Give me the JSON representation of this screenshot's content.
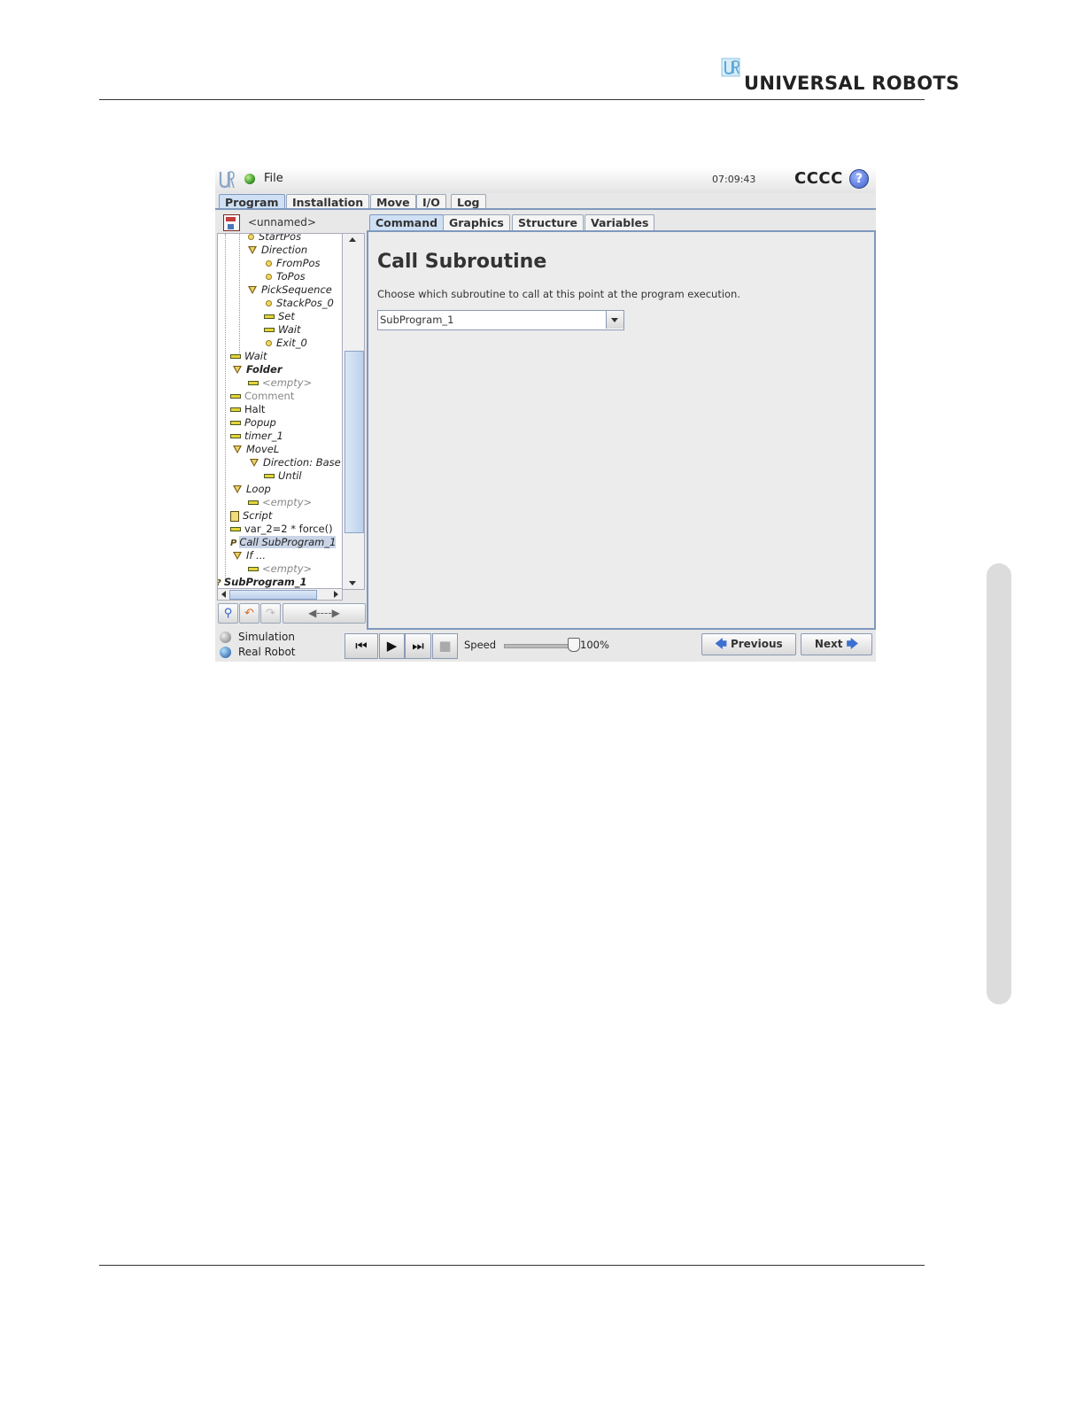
{
  "page": {
    "brand": "UNIVERSAL ROBOTS"
  },
  "header": {
    "file_menu": "File",
    "clock": "07:09:43",
    "robot_name": "CCCC",
    "help": "?"
  },
  "main_tabs": [
    {
      "label": "Program",
      "active": true
    },
    {
      "label": "Installation",
      "active": false
    },
    {
      "label": "Move",
      "active": false
    },
    {
      "label": "I/O",
      "active": false
    },
    {
      "label": "Log",
      "active": false
    }
  ],
  "sub_tabs": [
    {
      "label": "Command",
      "active": true
    },
    {
      "label": "Graphics",
      "active": false
    },
    {
      "label": "Structure",
      "active": false
    },
    {
      "label": "Variables",
      "active": false
    }
  ],
  "program": {
    "name": "<unnamed>"
  },
  "tree": [
    {
      "label": "StartPos",
      "icon": "waypoint-icon"
    },
    {
      "label": "Direction",
      "icon": "folder-triangle-icon"
    },
    {
      "label": "FromPos",
      "icon": "waypoint-icon"
    },
    {
      "label": "ToPos",
      "icon": "waypoint-icon"
    },
    {
      "label": "PickSequence",
      "icon": "folder-triangle-icon"
    },
    {
      "label": "StackPos_0",
      "icon": "waypoint-icon"
    },
    {
      "label": "Set",
      "icon": "command-bar-icon"
    },
    {
      "label": "Wait",
      "icon": "command-bar-icon"
    },
    {
      "label": "Exit_0",
      "icon": "waypoint-icon"
    },
    {
      "label": "Wait",
      "icon": "command-bar-icon"
    },
    {
      "label": "Folder",
      "icon": "folder-triangle-icon"
    },
    {
      "label": "<empty>",
      "icon": "command-bar-icon"
    },
    {
      "label": "Comment",
      "icon": "command-bar-icon"
    },
    {
      "label": "Halt",
      "icon": "command-bar-icon"
    },
    {
      "label": "Popup",
      "icon": "command-bar-icon"
    },
    {
      "label": "timer_1",
      "icon": "command-bar-icon"
    },
    {
      "label": "MoveL",
      "icon": "folder-triangle-icon"
    },
    {
      "label": "Direction: Base",
      "icon": "folder-triangle-icon"
    },
    {
      "label": "Until",
      "icon": "command-bar-icon"
    },
    {
      "label": "Loop",
      "icon": "folder-triangle-icon"
    },
    {
      "label": "<empty>",
      "icon": "command-bar-icon"
    },
    {
      "label": "Script",
      "icon": "script-icon"
    },
    {
      "label": "var_2=2 * force()",
      "icon": "command-bar-icon"
    },
    {
      "label": "Call SubProgram_1",
      "icon": "call-icon"
    },
    {
      "label": "If ...",
      "icon": "folder-triangle-icon"
    },
    {
      "label": "<empty>",
      "icon": "command-bar-icon"
    },
    {
      "label": "SubProgram_1",
      "icon": "call-icon"
    }
  ],
  "tree_toolbar": {
    "move_label": "◀----▶"
  },
  "command": {
    "title": "Call Subroutine",
    "description": "Choose which subroutine to call at this point at the program execution.",
    "selected_subroutine": "SubProgram_1"
  },
  "footer": {
    "simulation_label": "Simulation",
    "real_robot_label": "Real Robot",
    "speed_label": "Speed",
    "speed_value": "100%",
    "speed_fraction": 1.0,
    "previous_label": "Previous",
    "next_label": "Next"
  }
}
